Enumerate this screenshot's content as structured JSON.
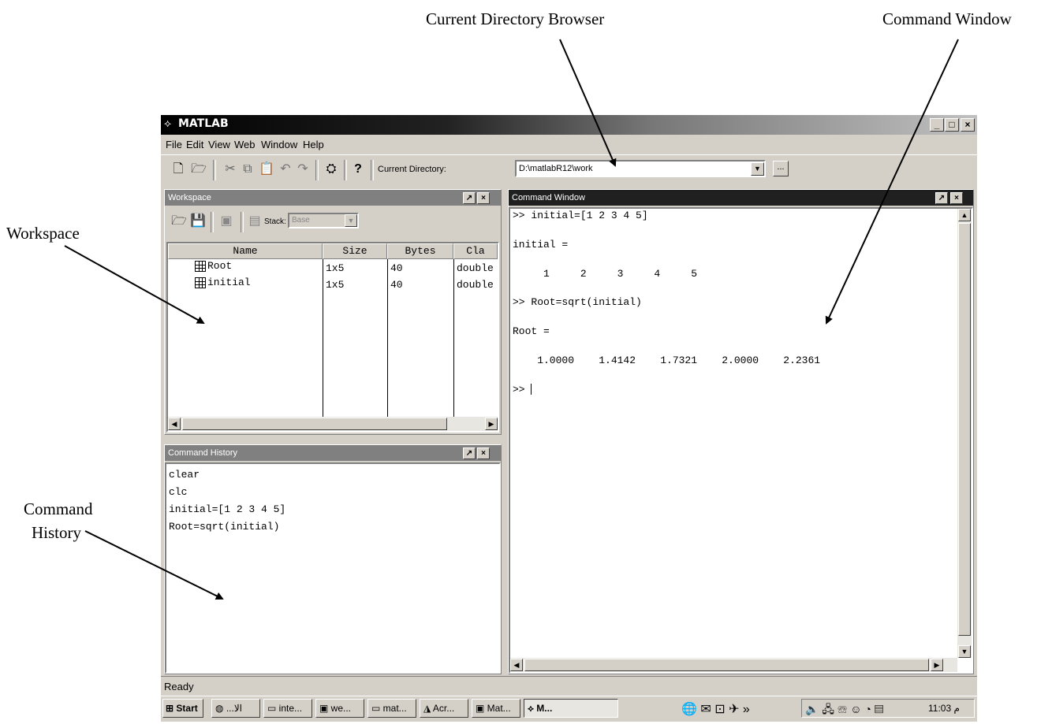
{
  "annotations": {
    "current_directory_browser": "Current Directory Browser",
    "command_window": "Command Window",
    "workspace": "Workspace",
    "command_history_line1": "Command",
    "command_history_line2": "History"
  },
  "app": {
    "title": "MATLAB",
    "window_controls": [
      "_",
      "□",
      "×"
    ]
  },
  "menu": [
    "File",
    "Edit",
    "View",
    "Web",
    "Window",
    "Help"
  ],
  "toolbar": {
    "current_directory_label": "Current Directory:",
    "current_directory_value": "D:\\matlabR12\\work",
    "browse_label": "...",
    "help_label": "?"
  },
  "workspace": {
    "title": "Workspace",
    "stack_label": "Stack:",
    "stack_value": "Base",
    "columns": [
      "Name",
      "Size",
      "Bytes",
      "Cla"
    ],
    "rows": [
      {
        "name": "Root",
        "size": "1x5",
        "bytes": "40",
        "class": "double"
      },
      {
        "name": "initial",
        "size": "1x5",
        "bytes": "40",
        "class": "double"
      }
    ]
  },
  "history": {
    "title": "Command History",
    "items": [
      "clear",
      "clc",
      "initial=[1 2 3 4 5]",
      "Root=sqrt(initial)"
    ]
  },
  "command_window": {
    "title": "Command Window",
    "lines": [
      ">> initial=[1 2 3 4 5]",
      "",
      "initial =",
      "",
      "     1     2     3     4     5",
      "",
      ">> Root=sqrt(initial)",
      "",
      "Root =",
      "",
      "    1.0000    1.4142    1.7321    2.0000    2.2361",
      "",
      ">> "
    ]
  },
  "status": {
    "text": "Ready"
  },
  "taskbar": {
    "start": "Start",
    "items": [
      "...الا",
      "inte...",
      "we...",
      "mat...",
      "Acr...",
      "Mat...",
      "M..."
    ],
    "clock": "11:03 م"
  }
}
